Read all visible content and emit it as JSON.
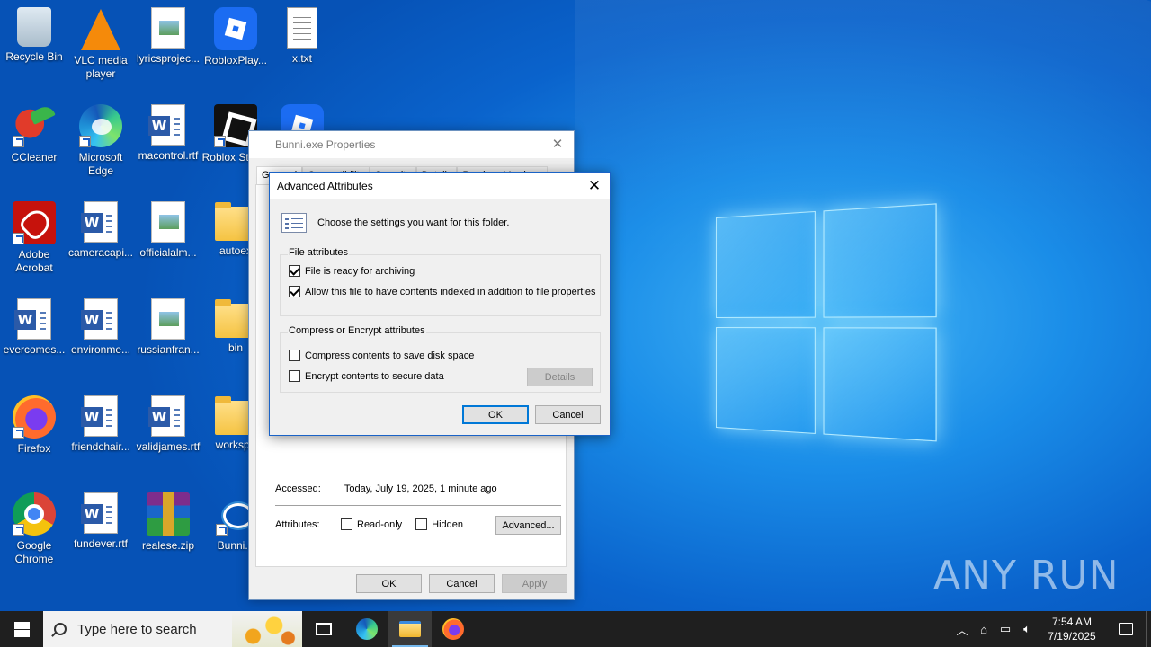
{
  "desktop": {
    "icons": [
      {
        "label": "Recycle Bin",
        "icon": "recycle-bin-icon"
      },
      {
        "label": "VLC media player",
        "icon": "vlc-icon"
      },
      {
        "label": "lyricsprojec...",
        "icon": "image-file-icon"
      },
      {
        "label": "RobloxPlay...",
        "icon": "roblox-player-icon"
      },
      {
        "label": "x.txt",
        "icon": "text-file-icon"
      },
      {
        "label": "CCleaner",
        "icon": "ccleaner-icon"
      },
      {
        "label": "Microsoft Edge",
        "icon": "edge-icon"
      },
      {
        "label": "macontrol.rtf",
        "icon": "word-document-icon"
      },
      {
        "label": "Roblox Studio",
        "icon": "roblox-studio-icon"
      },
      {
        "label": "",
        "icon": "roblox-player-icon"
      },
      {
        "label": "Adobe Acrobat",
        "icon": "acrobat-icon"
      },
      {
        "label": "cameracapi...",
        "icon": "word-document-icon"
      },
      {
        "label": "officialalm...",
        "icon": "image-file-icon"
      },
      {
        "label": "autoex",
        "icon": "folder-icon"
      },
      {
        "label": "evercomes...",
        "icon": "word-document-icon"
      },
      {
        "label": "environme...",
        "icon": "word-document-icon"
      },
      {
        "label": "russianfran...",
        "icon": "image-file-icon"
      },
      {
        "label": "bin",
        "icon": "folder-icon"
      },
      {
        "label": "Firefox",
        "icon": "firefox-icon"
      },
      {
        "label": "friendchair...",
        "icon": "word-document-icon"
      },
      {
        "label": "validjames.rtf",
        "icon": "word-document-icon"
      },
      {
        "label": "workspa",
        "icon": "folder-icon"
      },
      {
        "label": "Google Chrome",
        "icon": "chrome-icon"
      },
      {
        "label": "fundever.rtf",
        "icon": "word-document-icon"
      },
      {
        "label": "realese.zip",
        "icon": "winrar-icon"
      },
      {
        "label": "Bunni.e",
        "icon": "setup-shield-icon"
      }
    ],
    "watermark": "ANY RUN"
  },
  "properties_window": {
    "title": "Bunni.exe Properties",
    "tabs": [
      "General",
      "Compatibility",
      "Security",
      "Details",
      "Previous Versions"
    ],
    "accessed_label": "Accessed:",
    "accessed_value": "Today, July 19, 2025, 1 minute ago",
    "attributes_label": "Attributes:",
    "readonly_label": "Read-only",
    "hidden_label": "Hidden",
    "advanced_button": "Advanced...",
    "ok_button": "OK",
    "cancel_button": "Cancel",
    "apply_button": "Apply"
  },
  "advanced_dialog": {
    "title": "Advanced Attributes",
    "intro": "Choose the settings you want for this folder.",
    "file_attributes": {
      "title": "File attributes",
      "archiving": {
        "label": "File is ready for archiving",
        "checked": true
      },
      "indexing": {
        "label": "Allow this file to have contents indexed in addition to file properties",
        "checked": true
      }
    },
    "compress_encrypt": {
      "title": "Compress or Encrypt attributes",
      "compress": {
        "label": "Compress contents to save disk space",
        "checked": false
      },
      "encrypt": {
        "label": "Encrypt contents to secure data",
        "checked": false
      },
      "details_button": "Details"
    },
    "ok_button": "OK",
    "cancel_button": "Cancel"
  },
  "taskbar": {
    "search_placeholder": "Type here to search",
    "time": "7:54 AM",
    "date": "7/19/2025"
  }
}
